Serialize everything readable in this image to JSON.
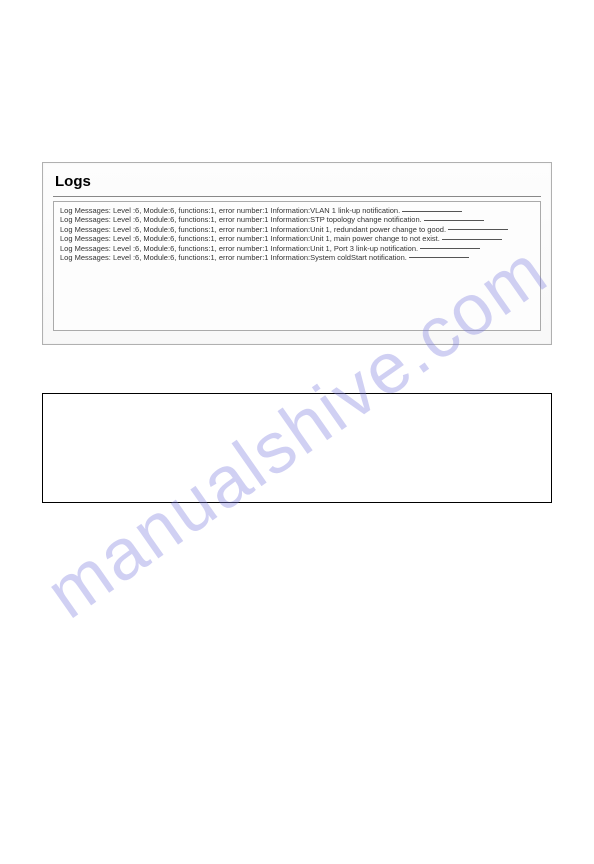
{
  "watermark": "manualshive.com",
  "logs": {
    "title": "Logs",
    "lines": [
      "Log Messages: Level :6, Module:6, functions:1, error number:1 Information:VLAN 1 link-up notification.",
      "Log Messages: Level :6, Module:6, functions:1, error number:1 Information:STP topology change notification.",
      "Log Messages: Level :6, Module:6, functions:1, error number:1 Information:Unit 1, redundant power change to good.",
      "Log Messages: Level :6, Module:6, functions:1, error number:1 Information:Unit 1, main power change to not exist.",
      "Log Messages: Level :6, Module:6, functions:1, error number:1 Information:Unit 1, Port 3 link-up notification.",
      "Log Messages: Level :6, Module:6, functions:1, error number:1 Information:System coldStart notification."
    ]
  }
}
